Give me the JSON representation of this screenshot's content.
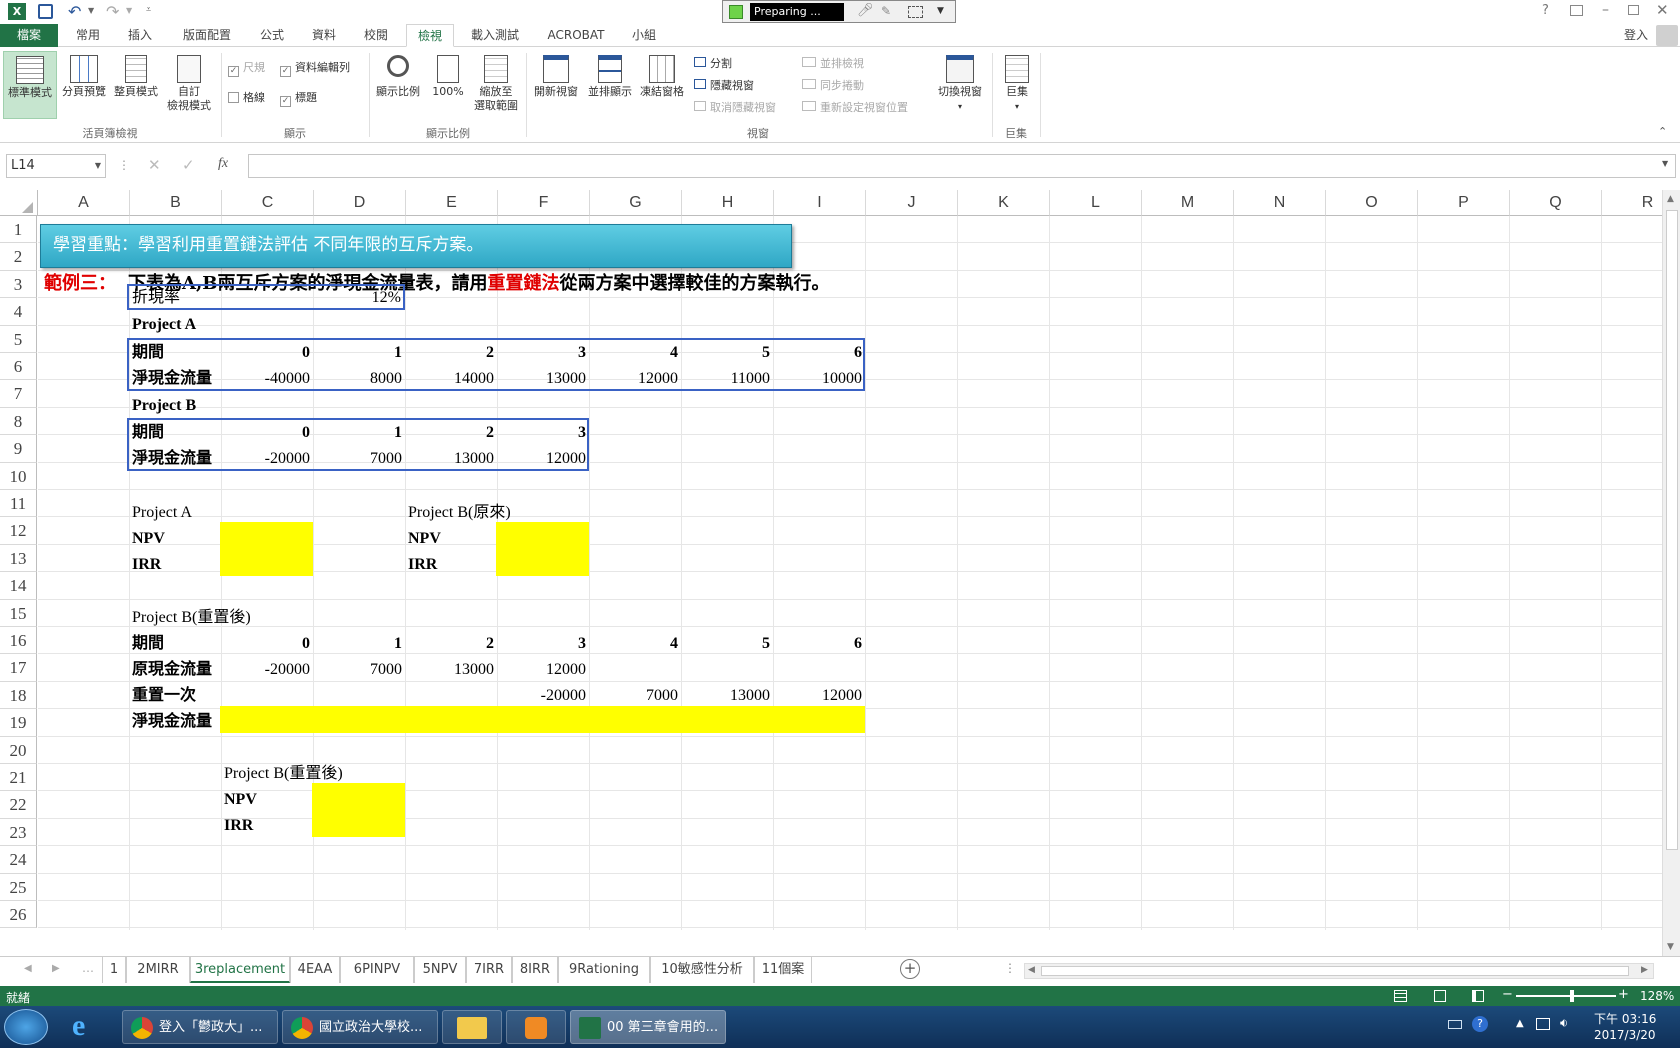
{
  "titlebar": {
    "preparing": "Preparing ...",
    "help": "?",
    "signin": "登入"
  },
  "tabs": [
    "檔案",
    "常用",
    "插入",
    "版面配置",
    "公式",
    "資料",
    "校閱",
    "檢視",
    "載入測試",
    "ACROBAT",
    "小組"
  ],
  "ribbon": {
    "workbook_views": {
      "normal": "標準模式",
      "page_break": "分頁預覽",
      "page_layout": "整頁模式",
      "custom1": "自訂",
      "custom2": "檢視模式",
      "label": "活頁簿檢視"
    },
    "show": {
      "ruler": "尺規",
      "formula_bar": "資料編輯列",
      "gridlines": "格線",
      "headings": "標題",
      "label": "顯示"
    },
    "zoom": {
      "zoom": "顯示比例",
      "hundred": "100%",
      "sel1": "縮放至",
      "sel2": "選取範圍",
      "label": "顯示比例"
    },
    "window": {
      "new_window": "開新視窗",
      "arrange": "並排顯示",
      "freeze": "凍結窗格",
      "split": "分割",
      "hide": "隱藏視窗",
      "unhide": "取消隱藏視窗",
      "side_by_side": "並排檢視",
      "sync": "同步捲動",
      "reset": "重新設定視窗位置",
      "label": "視窗"
    },
    "switch": {
      "label": "切換視窗"
    },
    "macros": {
      "macros": "巨集",
      "label": "巨集"
    }
  },
  "formula_bar": {
    "name_box": "L14",
    "fx": "fx",
    "content": ""
  },
  "columns": [
    "A",
    "B",
    "C",
    "D",
    "E",
    "F",
    "G",
    "H",
    "I",
    "J",
    "K",
    "L",
    "M",
    "N",
    "O",
    "P",
    "Q",
    "R"
  ],
  "rows": [
    "1",
    "2",
    "3",
    "4",
    "5",
    "6",
    "7",
    "8",
    "9",
    "10",
    "11",
    "12",
    "13",
    "14",
    "15",
    "16",
    "17",
    "18",
    "19",
    "20",
    "21",
    "22",
    "23",
    "24",
    "25",
    "26"
  ],
  "sheet": {
    "banner": "學習重點：學習利用重置鏈法評估 不同年限的互斥方案。",
    "example_label": "範例三：",
    "example_text_1": "下表為A,B兩互斥方案的淨現金流量表，請用",
    "example_text_red": "重置鏈法",
    "example_text_2": "從兩方案中選擇較佳的方案執行。",
    "discount_label": "折現率",
    "discount_value": "12%",
    "projA_title": "Project A",
    "period_label": "期間",
    "ncf_label": "淨現金流量",
    "projA_periods": [
      "0",
      "1",
      "2",
      "3",
      "4",
      "5",
      "6"
    ],
    "projA_flows": [
      "-40000",
      "8000",
      "14000",
      "13000",
      "12000",
      "11000",
      "10000"
    ],
    "projB_title": "Project B",
    "projB_periods": [
      "0",
      "1",
      "2",
      "3"
    ],
    "projB_flows": [
      "-20000",
      "7000",
      "13000",
      "12000"
    ],
    "resA_title": "Project A",
    "npv": "NPV",
    "irr": "IRR",
    "resB_title": "Project B(原來)",
    "replB_title": "Project B(重置後)",
    "repl_periods": [
      "0",
      "1",
      "2",
      "3",
      "4",
      "5",
      "6"
    ],
    "orig_flow_label": "原現金流量",
    "orig_flows": [
      "-20000",
      "7000",
      "13000",
      "12000"
    ],
    "reset_label": "重置一次",
    "reset_flows": [
      "-20000",
      "7000",
      "13000",
      "12000"
    ],
    "net_flow_label": "淨現金流量",
    "res_repl_title": "Project B(重置後)"
  },
  "sheet_tabs": [
    "1",
    "2MIRR",
    "3replacement",
    "4EAA",
    "6PINPV",
    "5NPV",
    "7IRR",
    "8IRR",
    "9Rationing",
    "10敏感性分析",
    "11個案"
  ],
  "active_sheet": "3replacement",
  "status": {
    "ready": "就緒",
    "zoom": "128%"
  },
  "taskbar": {
    "items": [
      "登入「鬱政大」...",
      "國立政治大學校...",
      "",
      "",
      "00 第三章會用的..."
    ],
    "time": "下午 03:16",
    "date": "2017/3/20"
  },
  "colors": {
    "excel_green": "#217346",
    "banner": "#2fb4cf",
    "yellow": "#ffff00",
    "box": "#3a62c4",
    "red": "#e00000"
  }
}
